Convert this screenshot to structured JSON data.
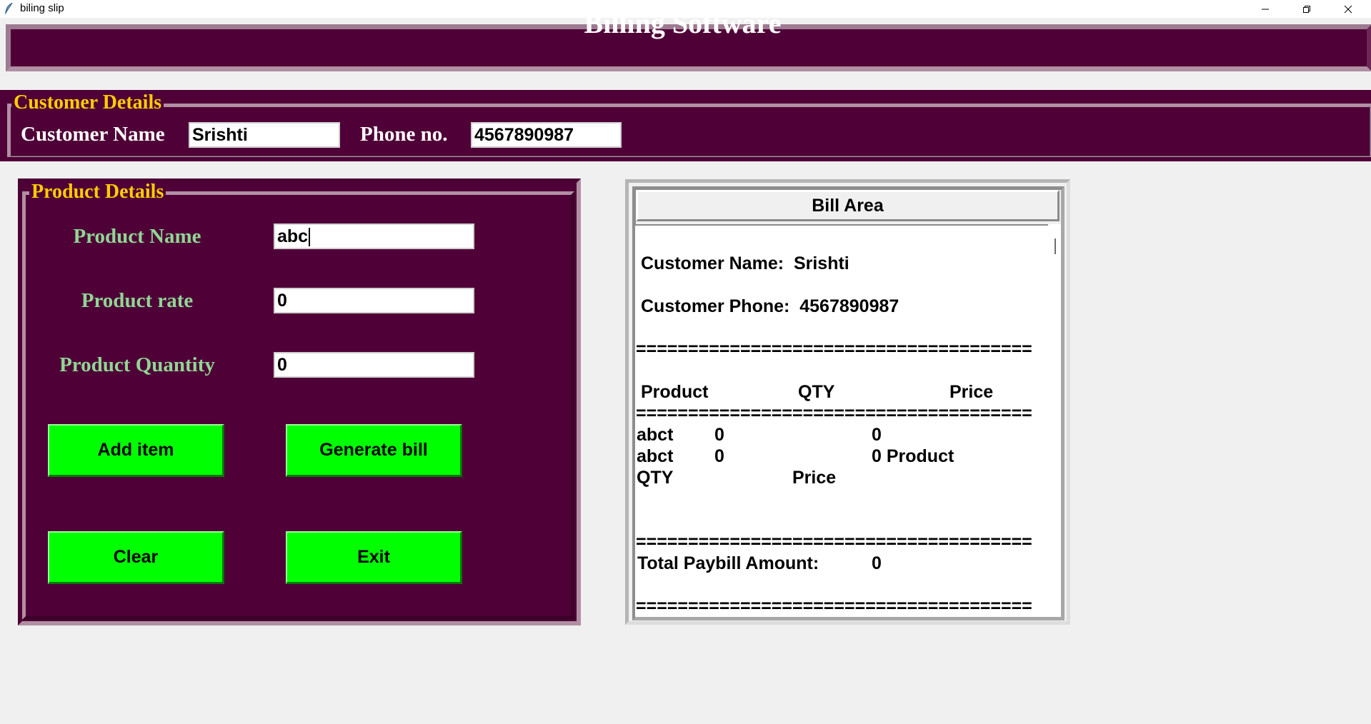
{
  "window": {
    "title": "biling slip",
    "controls": [
      "minimize-icon",
      "restore-icon",
      "close-icon"
    ]
  },
  "header": {
    "title": "Billing Software"
  },
  "customer": {
    "legend": "Customer Details",
    "name_label": "Customer Name",
    "name_value": "Srishti",
    "phone_label": "Phone no.",
    "phone_value": "4567890987"
  },
  "product": {
    "legend": "Product Details",
    "name_label": "Product Name",
    "name_value": "abc",
    "rate_label": "Product rate",
    "rate_value": "0",
    "qty_label": "Product Quantity",
    "qty_value": "0",
    "buttons": {
      "add": "Add item",
      "generate": "Generate bill",
      "clear": "Clear",
      "exit": "Exit"
    }
  },
  "bill": {
    "header": "Bill Area",
    "customer_name_line": "Customer Name:  Srishti",
    "customer_phone_line": "Customer Phone:  4567890987",
    "separator": "======================================",
    "col_product": "Product",
    "col_qty": "QTY",
    "col_price": "Price",
    "rows": [
      {
        "name": "abct",
        "qty": "0",
        "price": "0"
      },
      {
        "name": "abct",
        "qty": "0",
        "price": "0 Product"
      }
    ],
    "wrap_qty": "QTY",
    "wrap_price": "Price",
    "total_label": "Total Paybill Amount:",
    "total_value": "0"
  },
  "colors": {
    "panel_bg": "#4f0037",
    "legend_text": "#ffcc00",
    "product_label_text": "#8fd694",
    "button_bg": "#00ff00",
    "window_bg": "#f0f0f0"
  }
}
